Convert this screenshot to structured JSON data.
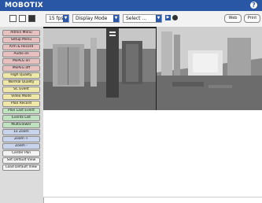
{
  "header": {
    "logo": "MOBOTIX",
    "help_icon": "help-icon"
  },
  "toolbar": {
    "fps": "15 fps",
    "display_mode": "Display Mode",
    "select": "Select ...",
    "button1": "Web",
    "button2": "Print"
  },
  "sidebar": {
    "items": [
      {
        "label": "Admin Menu",
        "color": "red"
      },
      {
        "label": "Setup Menu",
        "color": "red"
      },
      {
        "label": "Arm & Record",
        "color": "red"
      },
      {
        "label": "Audio on",
        "color": "red"
      },
      {
        "label": "MxPEG on",
        "color": "red"
      },
      {
        "label": "MxPEG off",
        "color": "red"
      },
      {
        "label": "High Quality",
        "color": "yellow"
      },
      {
        "label": "Normal Quality",
        "color": "yellow"
      },
      {
        "label": "SC Event",
        "color": "yellow"
      },
      {
        "label": "Video Mode",
        "color": "yellow"
      },
      {
        "label": "Plan Record",
        "color": "yellow"
      },
      {
        "label": "Plan Last Event",
        "color": "green"
      },
      {
        "label": "Events List",
        "color": "green"
      },
      {
        "label": "Multiviewer",
        "color": "green"
      },
      {
        "label": "1x Zoom",
        "color": "blue"
      },
      {
        "label": "Zoom +",
        "color": "blue"
      },
      {
        "label": "Zoom -",
        "color": "blue"
      },
      {
        "label": "Center Pan",
        "color": "white"
      },
      {
        "label": "Set Default View",
        "color": "white"
      },
      {
        "label": "Load Default View",
        "color": "white"
      }
    ]
  }
}
